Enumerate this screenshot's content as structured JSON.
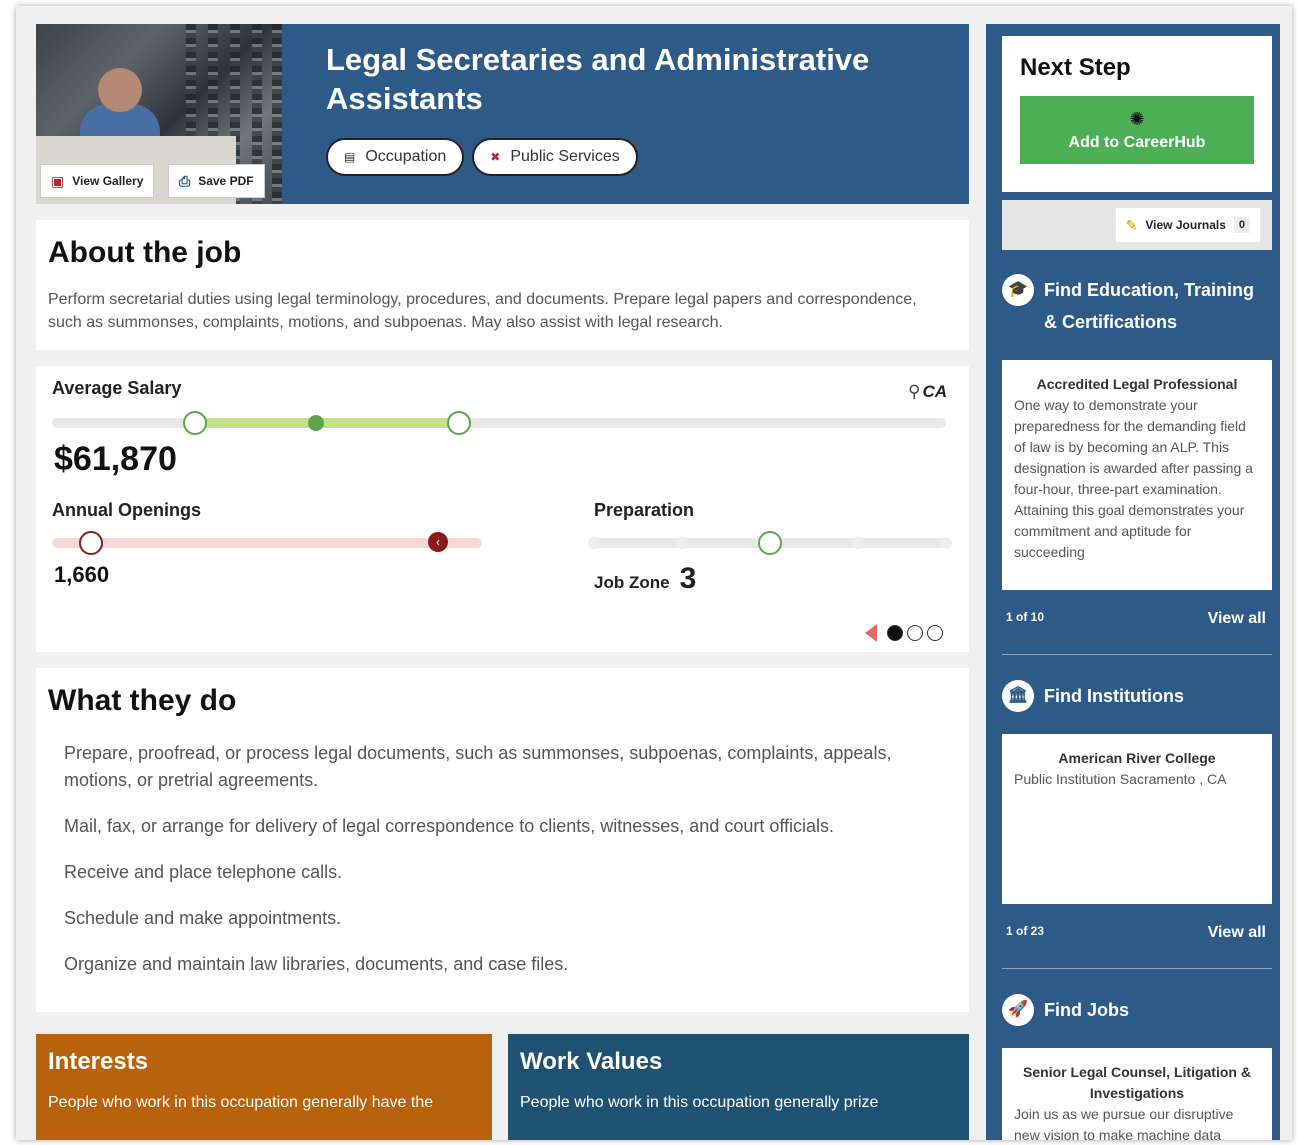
{
  "hero": {
    "title": "Legal Secretaries and Administrative Assistants",
    "gallery_label": "View Gallery",
    "pdf_label": "Save PDF",
    "tags": [
      {
        "icon": "briefcase-icon",
        "label": "Occupation"
      },
      {
        "icon": "public-services-icon",
        "label": "Public Services"
      }
    ]
  },
  "about": {
    "heading": "About the job",
    "description": "Perform secretarial duties using legal terminology, procedures, and documents. Prepare legal papers and correspondence, such as summonses, complaints, motions, and subpoenas. May also assist with legal research."
  },
  "stats": {
    "salary_label": "Average Salary",
    "location": "CA",
    "salary_value": "$61,870",
    "salary_range_fraction": [
      0.16,
      0.455
    ],
    "salary_median_fraction": 0.295,
    "openings_label": "Annual Openings",
    "openings_value": "1,660",
    "openings_fraction": 0.09,
    "preparation_label": "Preparation",
    "job_zone_label": "Job Zone",
    "job_zone_value": "3",
    "job_zone_level": 3,
    "job_zone_max": 5,
    "carousel_page": 1,
    "carousel_total": 3
  },
  "what": {
    "heading": "What they do",
    "tasks": [
      "Prepare, proofread, or process legal documents, such as summonses, subpoenas, complaints, appeals, motions, or pretrial agreements.",
      "Mail, fax, or arrange for delivery of legal correspondence to clients, witnesses, and court officials.",
      "Receive and place telephone calls.",
      "Schedule and make appointments.",
      "Organize and maintain law libraries, documents, and case files."
    ]
  },
  "tiles": {
    "interests": {
      "title": "Interests",
      "text": "People who work in this occupation generally have the"
    },
    "values": {
      "title": "Work Values",
      "text": "People who work in this occupation generally prize"
    }
  },
  "sidebar": {
    "next_step": "Next Step",
    "careerhub_label": "Add to CareerHub",
    "journals_label": "View Journals",
    "journals_count": "0",
    "education": {
      "heading_line1": "Find Education, Training",
      "heading_line2": "& Certifications",
      "card_title": "Accredited Legal Professional",
      "card_text": "One way to demonstrate your preparedness for the demanding field of law is by becoming an ALP. This designation is awarded after passing a four-hour, three-part examination. Attaining this goal demonstrates your commitment and aptitude for succeeding",
      "pager": "1 of 10",
      "view_all": "View all"
    },
    "institutions": {
      "heading": "Find Institutions",
      "card_title": "American River College",
      "card_text": "Public Institution Sacramento , CA",
      "pager": "1 of 23",
      "view_all": "View all"
    },
    "jobs": {
      "heading": "Find Jobs",
      "card_title": "Senior Legal Counsel, Litigation & Investigations",
      "card_text": "Join us as we pursue our disruptive new vision to make machine data"
    }
  },
  "colors": {
    "hero_blue": "#2e5a87",
    "salary_green": "#5aa54a",
    "openings_red": "#8b1a1a",
    "interests_orange": "#b8620d",
    "values_teal": "#1f5272",
    "careerhub_green": "#4cae55"
  }
}
